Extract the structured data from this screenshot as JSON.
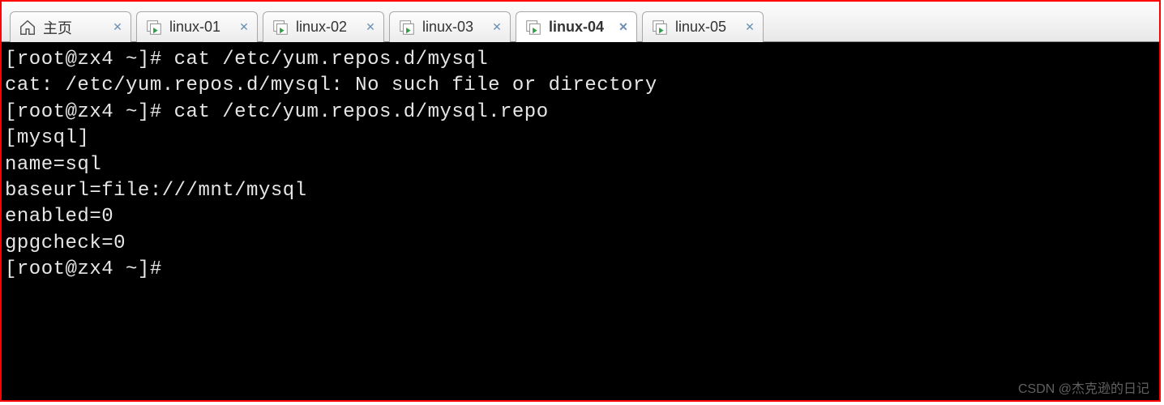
{
  "tabs": [
    {
      "label": "主页",
      "icon": "home-icon",
      "active": false
    },
    {
      "label": "linux-01",
      "icon": "vm-icon",
      "active": false
    },
    {
      "label": "linux-02",
      "icon": "vm-icon",
      "active": false
    },
    {
      "label": "linux-03",
      "icon": "vm-icon",
      "active": false
    },
    {
      "label": "linux-04",
      "icon": "vm-icon",
      "active": true
    },
    {
      "label": "linux-05",
      "icon": "vm-icon",
      "active": false
    }
  ],
  "terminal": {
    "lines": [
      "[root@zx4 ~]# cat /etc/yum.repos.d/mysql",
      "cat: /etc/yum.repos.d/mysql: No such file or directory",
      "[root@zx4 ~]# cat /etc/yum.repos.d/mysql.repo",
      "[mysql]",
      "name=sql",
      "baseurl=file:///mnt/mysql",
      "enabled=0",
      "gpgcheck=0",
      "[root@zx4 ~]# "
    ]
  },
  "watermark": "CSDN @杰克逊的日记"
}
